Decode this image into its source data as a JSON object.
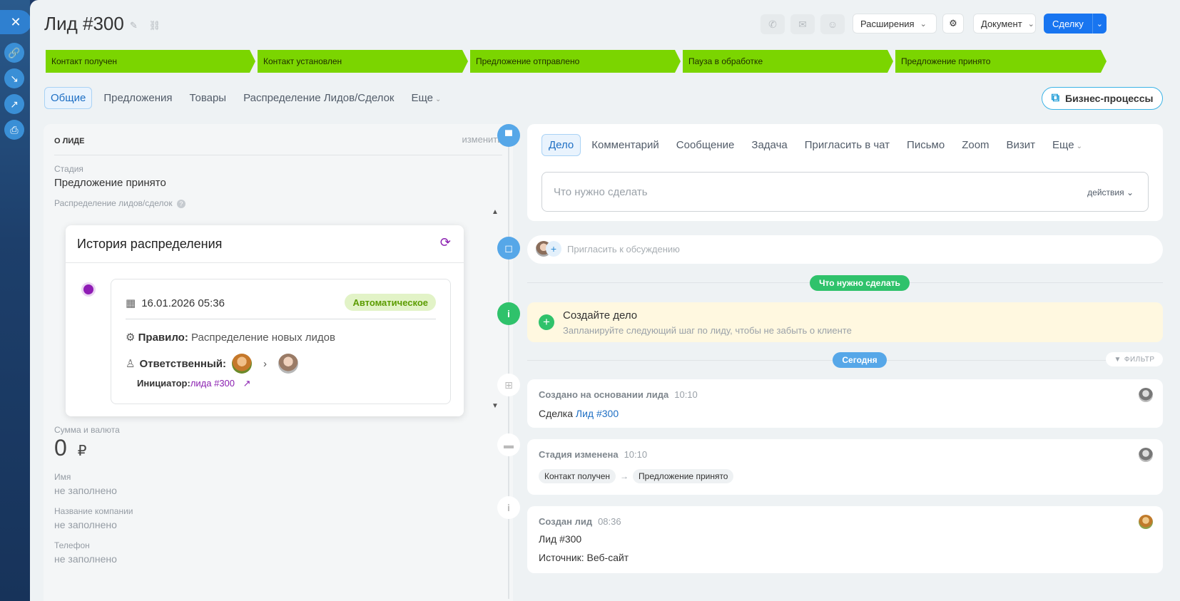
{
  "header": {
    "title": "Лид #300",
    "extensions_label": "Расширения",
    "document_label": "Документ",
    "convert_label": "Сделку"
  },
  "stages": [
    {
      "label": "Контакт получен"
    },
    {
      "label": "Контакт установлен"
    },
    {
      "label": "Предложение отправлено"
    },
    {
      "label": "Пауза в обработке"
    },
    {
      "label": "Предложение принято"
    }
  ],
  "tabs": [
    "Общие",
    "Предложения",
    "Товары",
    "Распределение Лидов/Сделок",
    "Еще"
  ],
  "bp_label": "Бизнес-процессы",
  "lead_card": {
    "heading": "О ЛИДЕ",
    "edit_label": "изменить",
    "stage_label": "Стадия",
    "stage_value": "Предложение принято",
    "distribution_label": "Распределение лидов/сделок",
    "amount_label": "Сумма и валюта",
    "amount_value": "0",
    "currency": "₽",
    "name_label": "Имя",
    "company_label": "Название компании",
    "phone_label": "Телефон",
    "empty": "не заполнено"
  },
  "history": {
    "title": "История распределения",
    "date": "16.01.2026 05:36",
    "badge": "Автоматическое",
    "rule_label": "Правило:",
    "rule_value": "Распределение новых лидов",
    "responsible_label": "Ответственный:",
    "initiator_label": "Инициатор:",
    "initiator_link": "лида #300"
  },
  "activity": {
    "tabs": [
      "Дело",
      "Комментарий",
      "Сообщение",
      "Задача",
      "Пригласить в чат",
      "Письмо",
      "Zoom",
      "Визит",
      "Еще"
    ],
    "placeholder": "Что нужно сделать",
    "actions_label": "действия"
  },
  "invite_placeholder": "Пригласить к обсуждению",
  "todo_pill": "Что нужно сделать",
  "todo": {
    "title": "Создайте дело",
    "subtitle": "Запланируйте следующий шаг по лиду, чтобы не забыть о клиенте"
  },
  "today_pill": "Сегодня",
  "filter_label": "ФИЛЬТР",
  "history_items": [
    {
      "title": "Создано на основании лида",
      "time": "10:10",
      "body_prefix": "Сделка",
      "body_link": "Лид #300"
    },
    {
      "title": "Стадия изменена",
      "time": "10:10",
      "from": "Контакт получен",
      "to": "Предложение принято"
    },
    {
      "title": "Создан лид",
      "time": "08:36",
      "line1": "Лид #300",
      "line2": "Источник: Веб-сайт"
    }
  ],
  "colors": {
    "stage_green": "#7bd500",
    "primary_blue": "#1875f0",
    "accent_purple": "#8f1cb5",
    "badge_green": "#5b9c00"
  }
}
